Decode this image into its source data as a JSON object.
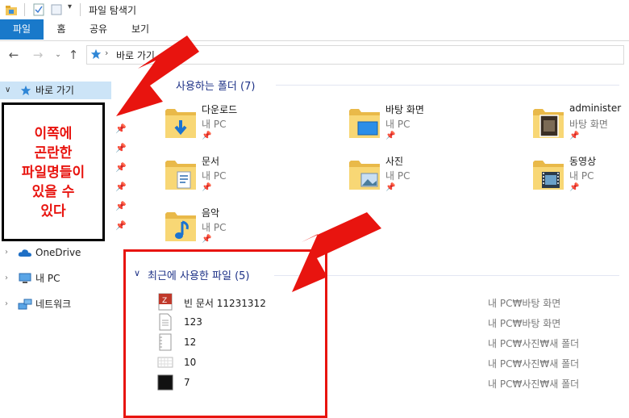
{
  "window": {
    "title": "파일 탐색기"
  },
  "ribbon": {
    "tabs": [
      "파일",
      "홈",
      "공유",
      "보기"
    ]
  },
  "address": {
    "path": "바로 가기"
  },
  "nav": {
    "quick_access": "바로 가기",
    "onedrive": "OneDrive",
    "this_pc": "내 PC",
    "network": "네트워크"
  },
  "annotation": {
    "text": "이쪽에\n곤란한\n파일명들이\n있을 수\n있다"
  },
  "frequent": {
    "header": "사용하는 폴더 (7)",
    "folders": [
      {
        "name": "다운로드",
        "location": "내 PC",
        "icon": "download-icon"
      },
      {
        "name": "바탕 화면",
        "location": "내 PC",
        "icon": "desktop-icon"
      },
      {
        "name": "administer",
        "location": "바탕 화면",
        "icon": "photo-icon"
      },
      {
        "name": "문서",
        "location": "내 PC",
        "icon": "document-icon"
      },
      {
        "name": "사진",
        "location": "내 PC",
        "icon": "picture-icon"
      },
      {
        "name": "동영상",
        "location": "내 PC",
        "icon": "film-icon"
      },
      {
        "name": "음악",
        "location": "내 PC",
        "icon": "music-icon"
      }
    ]
  },
  "recent": {
    "header": "최근에 사용한 파일 (5)",
    "files": [
      {
        "name": "빈 문서 11231312",
        "path": "내 PC₩바탕 화면",
        "icon": "red-doc-icon"
      },
      {
        "name": "123",
        "path": "내 PC₩바탕 화면",
        "icon": "text-file-icon"
      },
      {
        "name": "12",
        "path": "내 PC₩사진₩새 폴더",
        "icon": "notebook-file-icon"
      },
      {
        "name": "10",
        "path": "내 PC₩사진₩새 폴더",
        "icon": "grid-file-icon"
      },
      {
        "name": "7",
        "path": "내 PC₩사진₩새 폴더",
        "icon": "black-file-icon"
      }
    ]
  },
  "colors": {
    "accent": "#1979ca",
    "annotation_red": "#e8140f",
    "group_header": "#1e3287"
  }
}
